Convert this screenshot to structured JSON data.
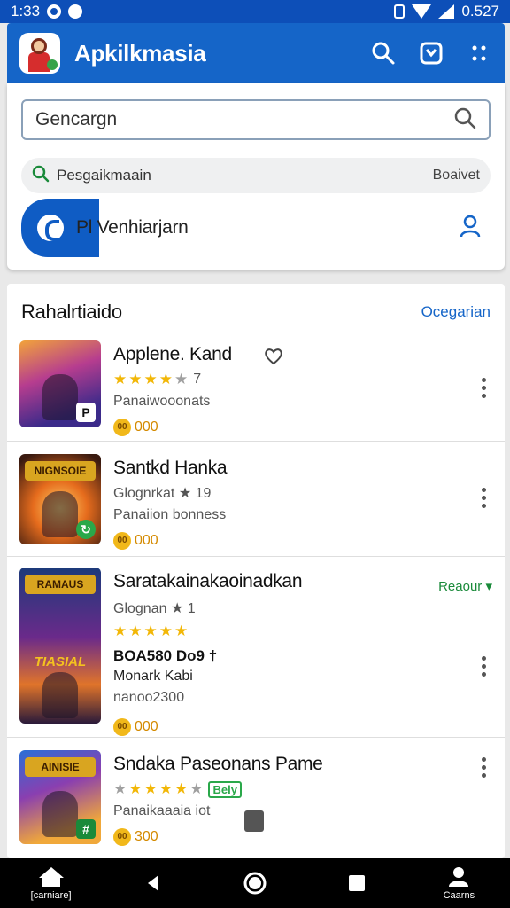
{
  "status_bar": {
    "time": "1:33",
    "battery": "0.527"
  },
  "app_bar": {
    "title": "Apkilkmasia"
  },
  "search": {
    "value": "Gencargn"
  },
  "suggestion": {
    "label": "Pesgaikmaain",
    "extra": "Boaivet"
  },
  "promo": {
    "label": "Pl Venhiarjarn"
  },
  "section": {
    "title": "Rahalrtiaido",
    "link": "Ocegarian"
  },
  "apps": [
    {
      "name": "Applene. Kand",
      "rating_text": "7",
      "subtitle": "Panaiwooonats",
      "price": "000",
      "coin": "00"
    },
    {
      "name": "Santkd Hanka",
      "rating_text": "Glognrkat ★ 19",
      "subtitle": "Panaiion bonness",
      "price": "000",
      "coin": "00",
      "banner": "NIGNSOIE"
    },
    {
      "name": "Saratakainakaoinadkan",
      "rating_text": "Glognan ★ 1",
      "bold_line": "BOA580 Do9 †",
      "line2": "Monark Kabi",
      "line3": "nanoo2300",
      "status": "Reaour ▾",
      "price": "000",
      "coin": "00",
      "banner": "RAMAUS",
      "banner2": "TIASIAL"
    },
    {
      "name": "Sndaka Paseonans Pame",
      "badge": "Bely",
      "subtitle": "Panaikaaaia iot",
      "price": "300",
      "coin": "00",
      "banner": "AINISIE"
    }
  ],
  "nav": {
    "home": "[carniare]",
    "account": "Caarns"
  },
  "colors": {
    "brand": "#1565c8",
    "status": "#0d4fb8",
    "price": "#d48a00",
    "star": "#f2b707"
  }
}
